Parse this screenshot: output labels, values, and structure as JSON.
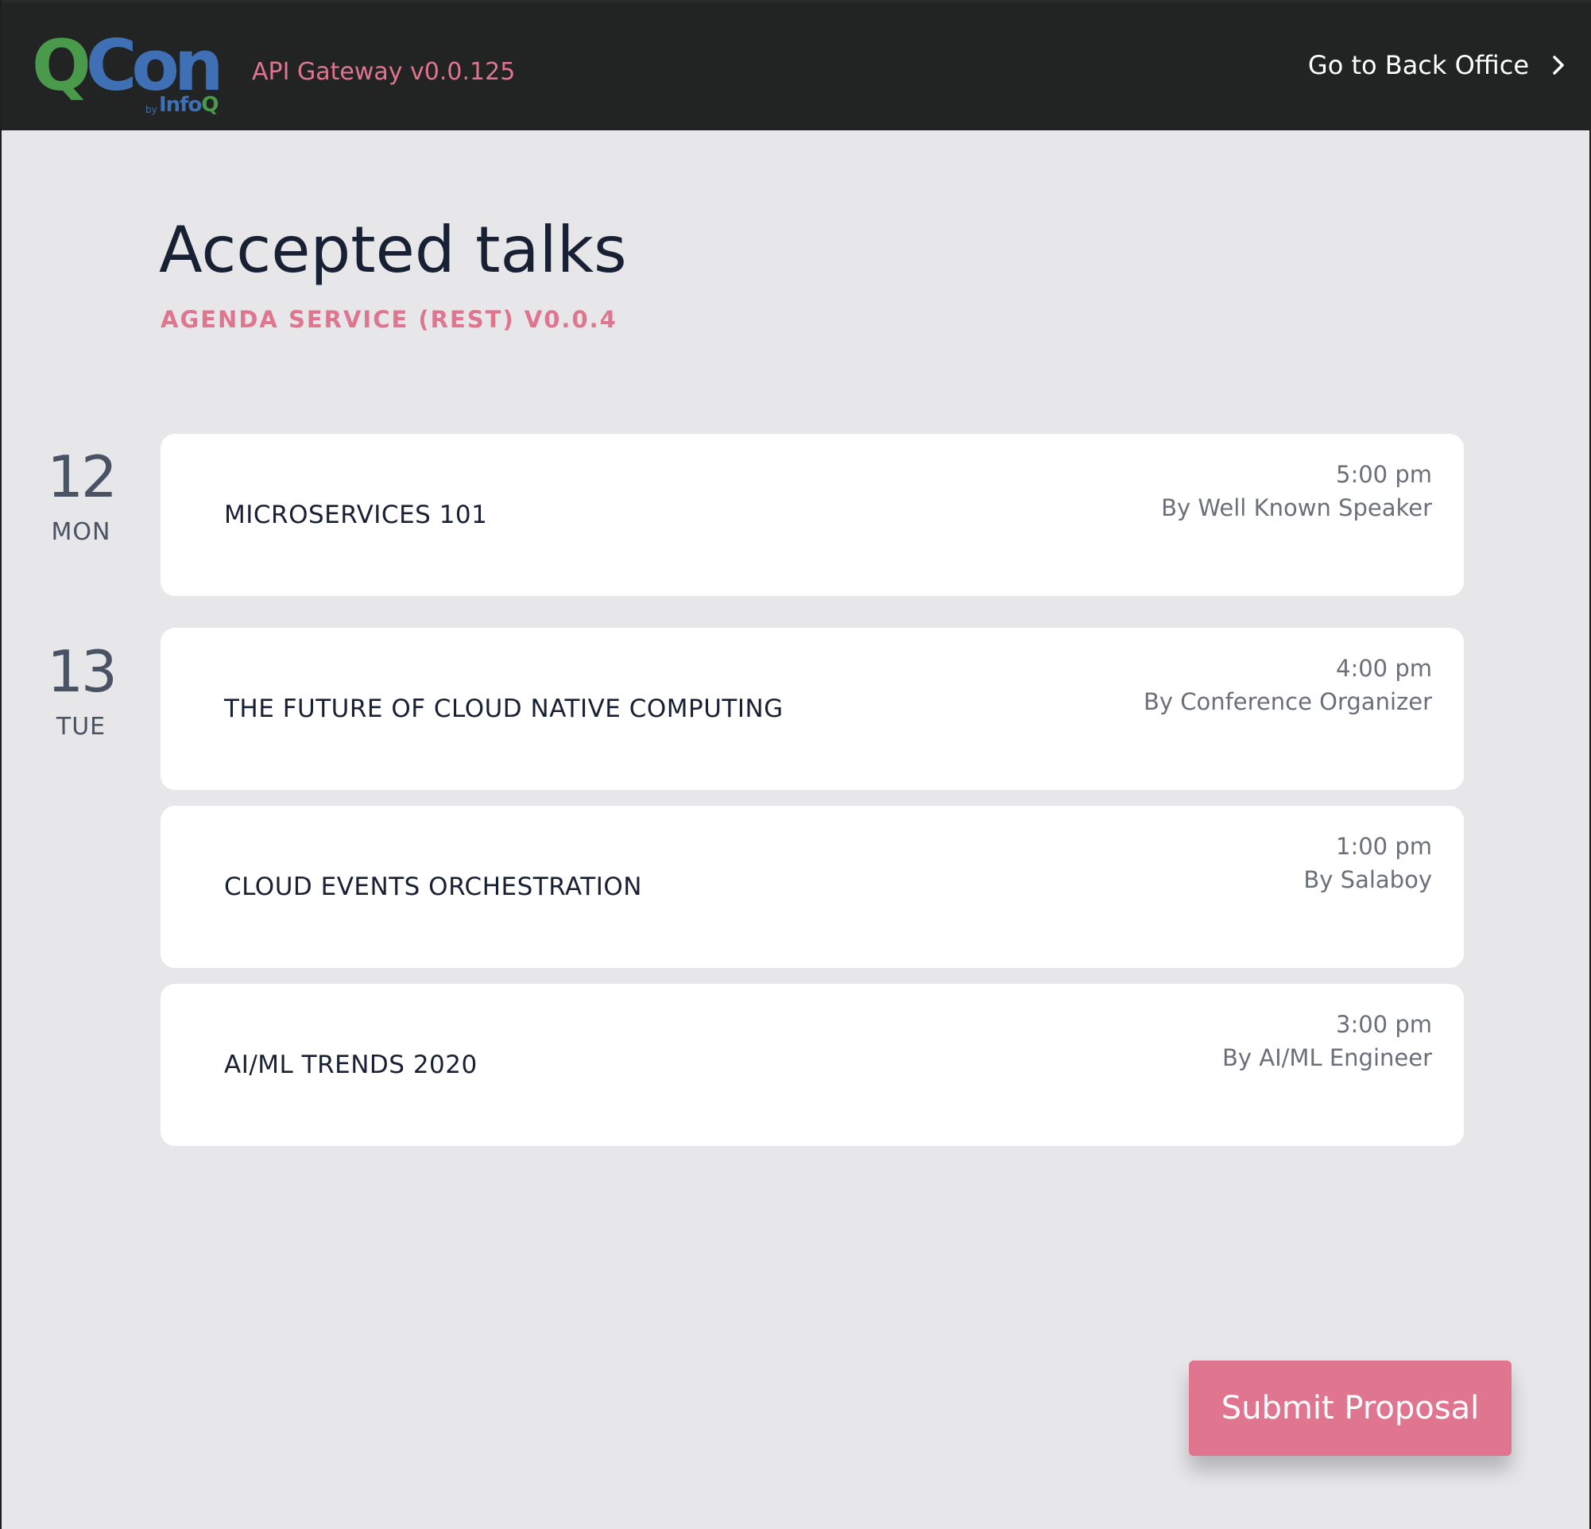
{
  "header": {
    "logo": {
      "q": "Q",
      "con": "Con",
      "by": "by",
      "info": "Info",
      "q2": "Q"
    },
    "gateway_label": "API Gateway v0.0.125",
    "back_office_label": "Go to Back Office",
    "back_office_icon": "chevron-right-icon"
  },
  "page": {
    "title": "Accepted talks",
    "subtitle": "AGENDA SERVICE (REST) V0.0.4"
  },
  "days": [
    {
      "number": "12",
      "name": "MON"
    },
    {
      "number": "13",
      "name": "TUE"
    }
  ],
  "talks": [
    {
      "title": "MICROSERVICES 101",
      "time": "5:00 pm",
      "speaker": "By Well Known Speaker"
    },
    {
      "title": "THE FUTURE OF CLOUD NATIVE COMPUTING",
      "time": "4:00 pm",
      "speaker": "By Conference Organizer"
    },
    {
      "title": "CLOUD EVENTS ORCHESTRATION",
      "time": "1:00 pm",
      "speaker": "By Salaboy"
    },
    {
      "title": "AI/ML TRENDS 2020",
      "time": "3:00 pm",
      "speaker": "By AI/ML Engineer"
    }
  ],
  "actions": {
    "submit_label": "Submit Proposal"
  },
  "colors": {
    "header_bg": "#222323",
    "page_bg": "#e7e7ea",
    "accent_pink": "#e0758f",
    "logo_green": "#4a9a4c",
    "logo_blue": "#3f70b5",
    "title_text": "#182033"
  }
}
